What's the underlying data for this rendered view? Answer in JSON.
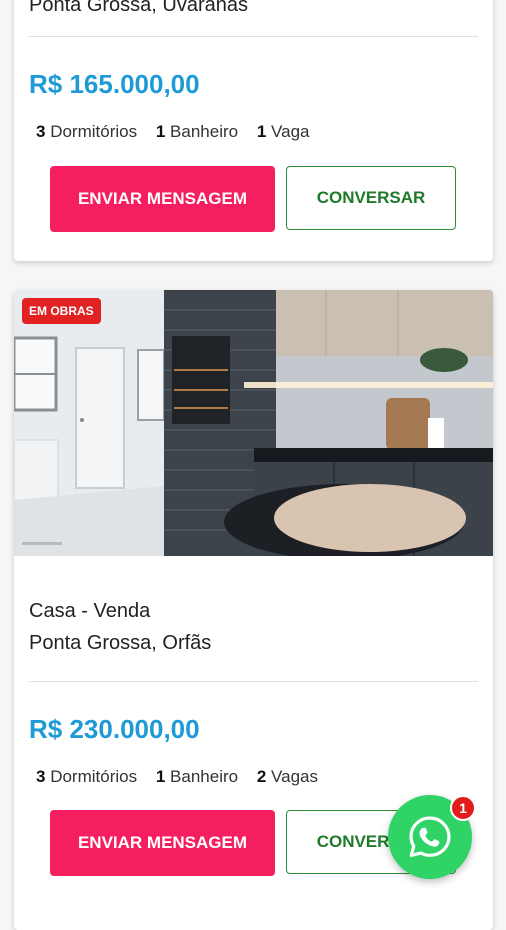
{
  "listings": [
    {
      "location": "Ponta Grossa, Uvaranas",
      "price": "R$ 165.000,00",
      "bedrooms_count": "3",
      "bedrooms_label": "Dormitórios",
      "bathrooms_count": "1",
      "bathrooms_label": "Banheiro",
      "parking_count": "1",
      "parking_label": "Vaga",
      "send_message_label": "ENVIAR MENSAGEM",
      "chat_label": "CONVERSAR"
    },
    {
      "badge": "EM OBRAS",
      "type_line": "Casa - Venda",
      "location": "Ponta Grossa, Orfãs",
      "price": "R$ 230.000,00",
      "bedrooms_count": "3",
      "bedrooms_label": "Dormitórios",
      "bathrooms_count": "1",
      "bathrooms_label": "Banheiro",
      "parking_count": "2",
      "parking_label": "Vagas",
      "send_message_label": "ENVIAR MENSAGEM",
      "chat_label": "CONVERSAR"
    }
  ],
  "whatsapp": {
    "icon": "whatsapp-icon",
    "notification_count": "1"
  },
  "colors": {
    "price": "#1e9ad6",
    "send_button": "#f51f5f",
    "chat_button_border": "#2e8b3a",
    "badge": "#e22222",
    "whatsapp": "#2fd366"
  }
}
